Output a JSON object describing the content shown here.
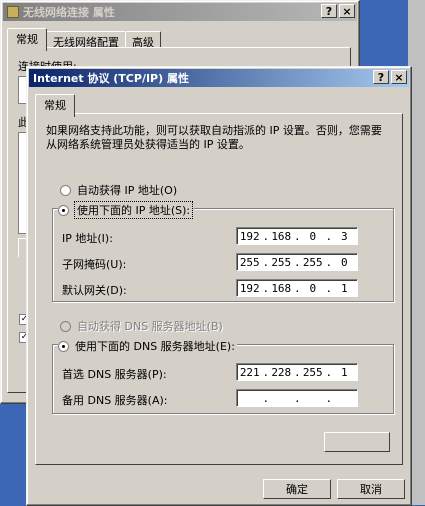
{
  "bg_window": {
    "title": "无线网络连接 属性",
    "tabs": [
      "常规",
      "无线网络配置",
      "高级"
    ],
    "connect_using_label": "连接时使用:",
    "partial_label": "此"
  },
  "dialog": {
    "title": "Internet 协议 (TCP/IP) 属性",
    "help_button": "?",
    "close_button": "×",
    "tab": "常规",
    "description": "如果网络支持此功能，则可以获取自动指派的 IP 设置。否则，您需要从网络系统管理员处获得适当的 IP 设置。",
    "auto_ip_label": "自动获得 IP 地址(O)",
    "manual_ip_label": "使用下面的 IP 地址(S):",
    "ip_label": "IP 地址(I):",
    "subnet_label": "子网掩码(U):",
    "gateway_label": "默认网关(D):",
    "ip_value": [
      "192",
      "168",
      "0",
      "3"
    ],
    "subnet_value": [
      "255",
      "255",
      "255",
      "0"
    ],
    "gateway_value": [
      "192",
      "168",
      "0",
      "1"
    ],
    "auto_dns_label": "自动获得 DNS 服务器地址(B)",
    "manual_dns_label": "使用下面的 DNS 服务器地址(E):",
    "preferred_dns_label": "首选 DNS 服务器(P):",
    "alternate_dns_label": "备用 DNS 服务器(A):",
    "preferred_dns_value": [
      "221",
      "228",
      "255",
      "1"
    ],
    "alternate_dns_value": [
      "",
      "",
      "",
      ""
    ],
    "ok_button": "确定",
    "cancel_button": "取消"
  },
  "colors": {
    "desktop": "#3b67b4",
    "title_active": "#0a246a",
    "face": "#d4d0c8"
  }
}
